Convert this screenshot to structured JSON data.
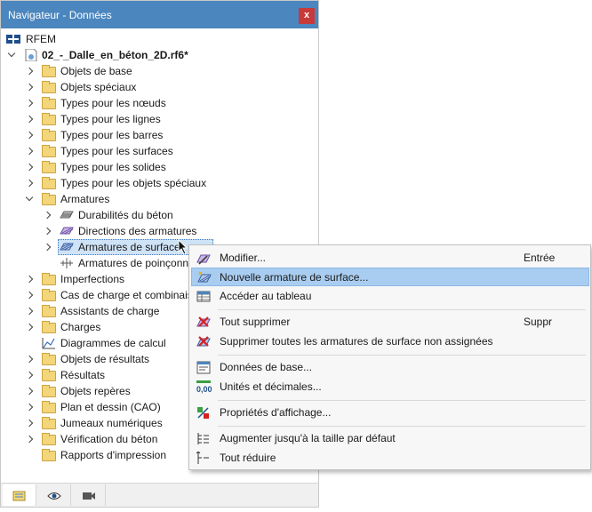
{
  "window": {
    "title": "Navigateur - Données",
    "close_label": "x"
  },
  "tree": {
    "root": "RFEM",
    "project": "02_-_Dalle_en_béton_2D.rf6*",
    "items_top": [
      "Objets de base",
      "Objets spéciaux",
      "Types pour les nœuds",
      "Types pour les lignes",
      "Types pour les barres",
      "Types pour les surfaces",
      "Types pour les solides",
      "Types pour les objets spéciaux"
    ],
    "armatures": "Armatures",
    "armatures_children": [
      "Durabilités du béton",
      "Directions des armatures",
      "Armatures de surface",
      "Armatures de poinçonnement"
    ],
    "items_bottom": [
      "Imperfections",
      "Cas de charge et combinaisons",
      "Assistants de charge",
      "Charges",
      "Diagrammes de calcul",
      "Objets de résultats",
      "Résultats",
      "Objets repères",
      "Plan et dessin (CAO)",
      "Jumeaux numériques",
      "Vérification du béton",
      "Rapports d'impression"
    ]
  },
  "context_menu": {
    "modify": "Modifier...",
    "modify_key": "Entrée",
    "new": "Nouvelle armature de surface...",
    "table": "Accéder au tableau",
    "delete_all": "Tout supprimer",
    "delete_key": "Suppr",
    "delete_unassigned": "Supprimer toutes les armatures de surface non assignées",
    "base_data": "Données de base...",
    "units": "Unités et décimales...",
    "display": "Propriétés d'affichage...",
    "expand": "Augmenter jusqu'à la taille par défaut",
    "collapse": "Tout réduire",
    "units_icon_text": "0,00"
  },
  "colors": {
    "titlebar": "#4b86be",
    "highlight": "#a9cdf0",
    "selection": "#cfe3f7",
    "close": "#c83a3a"
  }
}
